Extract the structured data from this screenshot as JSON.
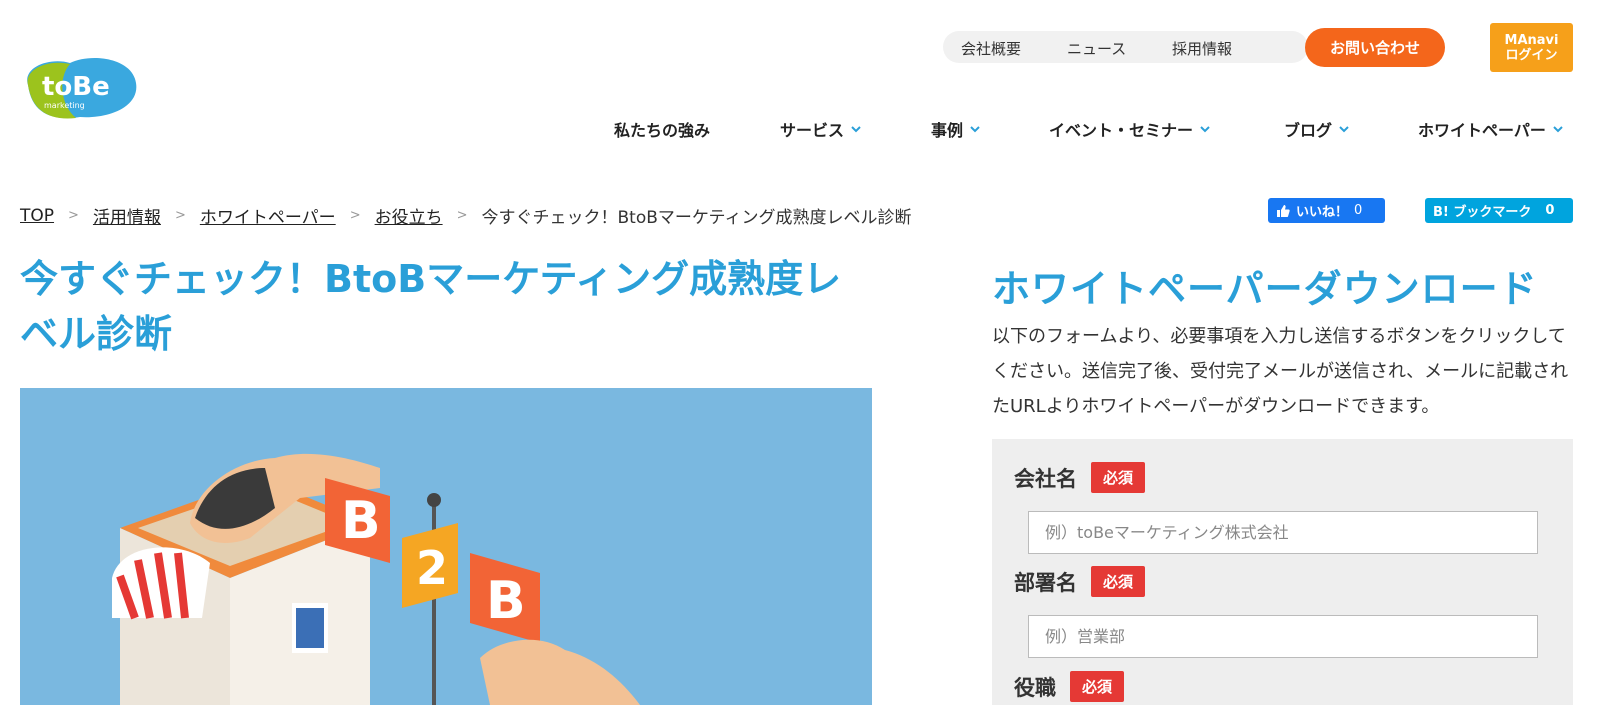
{
  "logo": {
    "main": "toBe",
    "sub": "marketing"
  },
  "util_nav": {
    "company": "会社概要",
    "news": "ニュース",
    "recruit": "採用情報"
  },
  "contact_label": "お問い合わせ",
  "manavi": {
    "line1": "MAnavi",
    "line2": "ログイン"
  },
  "main_nav": [
    {
      "label": "私たちの強み"
    },
    {
      "label": "サービス"
    },
    {
      "label": "事例"
    },
    {
      "label": "イベント・セミナー"
    },
    {
      "label": "ブログ"
    },
    {
      "label": "ホワイトペーパー"
    }
  ],
  "breadcrumb": {
    "items": [
      "TOP",
      "活用情報",
      "ホワイトペーパー",
      "お役立ち"
    ],
    "separator": ">",
    "current": "今すぐチェック！BtoBマーケティング成熟度レベル診断"
  },
  "social": {
    "fb_label": "いいね！",
    "fb_count": "0",
    "hatena_label": "B! ブックマーク",
    "hatena_count": "0"
  },
  "article": {
    "title": "今すぐチェック！BtoBマーケティング成熟度レベル診断"
  },
  "hero": {
    "tile1": "B",
    "tile2": "2",
    "tile3": "B"
  },
  "form": {
    "title": "ホワイトペーパーダウンロード",
    "description": "以下のフォームより、必要事項を入力し送信するボタンをクリックしてください。送信完了後、受付完了メールが送信され、メールに記載されたURLよりホワイトペーパーがダウンロードできます。",
    "required_label": "必須",
    "fields": [
      {
        "label": "会社名",
        "placeholder": "例）toBeマーケティング株式会社"
      },
      {
        "label": "部署名",
        "placeholder": "例）営業部"
      },
      {
        "label": "役職"
      }
    ]
  },
  "colors": {
    "accent_blue": "#2a9fd8",
    "contact_orange": "#f4661b",
    "manavi_orange": "#f6a01a",
    "required_red": "#e53935"
  }
}
